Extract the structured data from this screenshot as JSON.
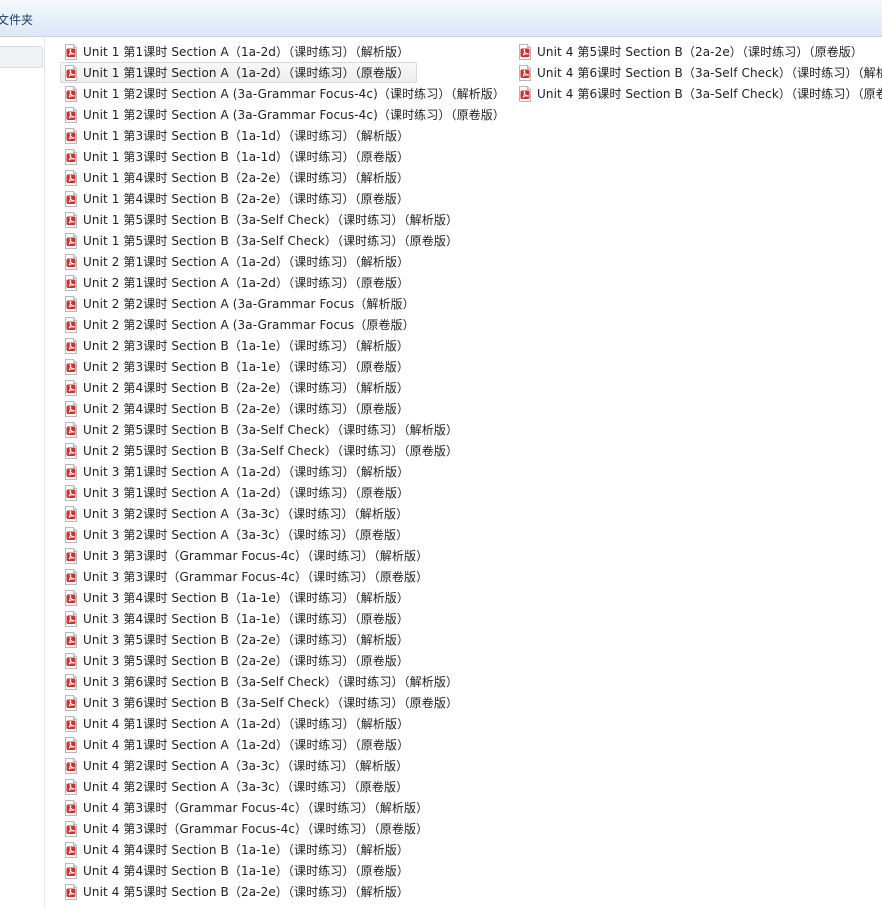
{
  "toolbar": {
    "new_folder_label": "文件夹"
  },
  "nav_pane": {
    "selected_item_label": ""
  },
  "icons": {
    "file_icon": "pdf-file-icon",
    "accent": "#d32f2f"
  },
  "files_col1": [
    "Unit 1 第1课时 Section A（1a-2d）（课时练习）（解析版）",
    "Unit 1 第1课时 Section A（1a-2d）（课时练习）（原卷版）",
    "Unit 1 第2课时 Section A (3a-Grammar Focus-4c)（课时练习）（解析版）",
    "Unit 1 第2课时 Section A (3a-Grammar Focus-4c)（课时练习）（原卷版）",
    "Unit 1 第3课时 Section B（1a-1d）（课时练习）（解析版）",
    "Unit 1 第3课时 Section B（1a-1d）（课时练习）（原卷版）",
    "Unit 1 第4课时 Section B（2a-2e）（课时练习）（解析版）",
    "Unit 1 第4课时 Section B（2a-2e）（课时练习）（原卷版）",
    "Unit 1 第5课时 Section B（3a-Self Check）（课时练习）（解析版）",
    "Unit 1 第5课时 Section B（3a-Self Check）（课时练习）（原卷版）",
    "Unit 2 第1课时 Section A（1a-2d）（课时练习）（解析版）",
    "Unit 2 第1课时 Section A（1a-2d）（课时练习）（原卷版）",
    "Unit 2 第2课时 Section A (3a-Grammar Focus（解析版）",
    "Unit 2 第2课时 Section A (3a-Grammar Focus（原卷版）",
    "Unit 2 第3课时 Section B（1a-1e）（课时练习）（解析版）",
    "Unit 2 第3课时 Section B（1a-1e）（课时练习）（原卷版）",
    "Unit 2 第4课时 Section B（2a-2e）（课时练习）（解析版）",
    "Unit 2 第4课时 Section B（2a-2e）（课时练习）（原卷版）",
    "Unit 2 第5课时 Section B（3a-Self Check）（课时练习）（解析版）",
    "Unit 2 第5课时 Section B（3a-Self Check）（课时练习）（原卷版）",
    "Unit 3 第1课时 Section A（1a-2d）（课时练习）（解析版）",
    "Unit 3 第1课时 Section A（1a-2d）（课时练习）（原卷版）",
    "Unit 3 第2课时 Section A（3a-3c）（课时练习）（解析版）",
    "Unit 3 第2课时 Section A（3a-3c）（课时练习）（原卷版）",
    "Unit 3 第3课时（Grammar Focus-4c）（课时练习）（解析版）",
    "Unit 3 第3课时（Grammar Focus-4c）（课时练习）（原卷版）",
    "Unit 3 第4课时 Section B（1a-1e）（课时练习）（解析版）",
    "Unit 3 第4课时 Section B（1a-1e）（课时练习）（原卷版）",
    "Unit 3 第5课时 Section B（2a-2e）（课时练习）（解析版）",
    "Unit 3 第5课时 Section B（2a-2e）（课时练习）（原卷版）",
    "Unit 3 第6课时 Section B（3a-Self Check）（课时练习）（解析版）",
    "Unit 3 第6课时 Section B（3a-Self Check）（课时练习）（原卷版）",
    "Unit 4 第1课时 Section A（1a-2d）（课时练习）（解析版）",
    "Unit 4 第1课时 Section A（1a-2d）（课时练习）（原卷版）",
    "Unit 4 第2课时 Section A（3a-3c）（课时练习）（解析版）",
    "Unit 4 第2课时 Section A（3a-3c）（课时练习）（原卷版）",
    "Unit 4 第3课时（Grammar Focus-4c）（课时练习）（解析版）",
    "Unit 4 第3课时（Grammar Focus-4c）（课时练习）（原卷版）",
    "Unit 4 第4课时 Section B（1a-1e）（课时练习）（解析版）",
    "Unit 4 第4课时 Section B（1a-1e）（课时练习）（原卷版）",
    "Unit 4 第5课时 Section B（2a-2e）（课时练习）（解析版）"
  ],
  "files_col2": [
    "Unit 4 第5课时 Section B（2a-2e）（课时练习）（原卷版）",
    "Unit 4 第6课时 Section B（3a-Self Check）（课时练习）（解析版）",
    "Unit 4 第6课时 Section B（3a-Self Check）（课时练习）（原卷版）"
  ],
  "selected_file_index": 1
}
